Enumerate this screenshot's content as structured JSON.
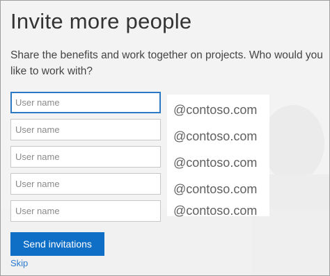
{
  "header": {
    "title": "Invite more people",
    "description": "Share the benefits and work together on projects. Who would you like to work with?"
  },
  "invite_rows": [
    {
      "placeholder": "User name",
      "domain": "@contoso.com"
    },
    {
      "placeholder": "User name",
      "domain": "@contoso.com"
    },
    {
      "placeholder": "User name",
      "domain": "@contoso.com"
    },
    {
      "placeholder": "User name",
      "domain": "@contoso.com"
    },
    {
      "placeholder": "User name",
      "domain": "@contoso.com"
    }
  ],
  "actions": {
    "send_label": "Send invitations",
    "skip_label": "Skip"
  },
  "colors": {
    "accent": "#0f6fc6",
    "link": "#2b7ad0",
    "focus_border": "#2b78c5"
  }
}
